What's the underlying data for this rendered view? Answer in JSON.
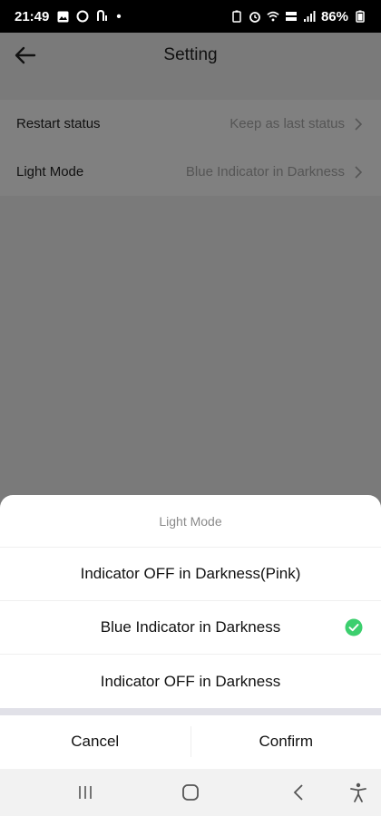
{
  "status_bar": {
    "time": "21:49",
    "dot": "•",
    "battery_percent": "86%",
    "icons": [
      "gallery-icon",
      "circle-app-icon",
      "notification-app-icon",
      "battery-saver-icon",
      "alarm-icon",
      "wifi-icon",
      "volte-icon",
      "signal-icon",
      "battery-icon"
    ]
  },
  "header": {
    "title": "Setting",
    "back_icon": "arrow-left-icon"
  },
  "settings": {
    "rows": [
      {
        "label": "Restart status",
        "value": "Keep as last status"
      },
      {
        "label": "Light Mode",
        "value": "Blue Indicator in Darkness"
      }
    ]
  },
  "sheet": {
    "title": "Light Mode",
    "options": [
      {
        "label": "Indicator OFF in Darkness(Pink)",
        "selected": false
      },
      {
        "label": "Blue Indicator in Darkness",
        "selected": true
      },
      {
        "label": "Indicator OFF in Darkness",
        "selected": false
      }
    ],
    "cancel_label": "Cancel",
    "confirm_label": "Confirm"
  },
  "colors": {
    "check_green": "#3ccf6e",
    "overlay_gray": "#7a7a7a"
  },
  "nav_bar": {
    "icons": [
      "recents-icon",
      "home-icon",
      "back-icon",
      "accessibility-icon"
    ]
  }
}
